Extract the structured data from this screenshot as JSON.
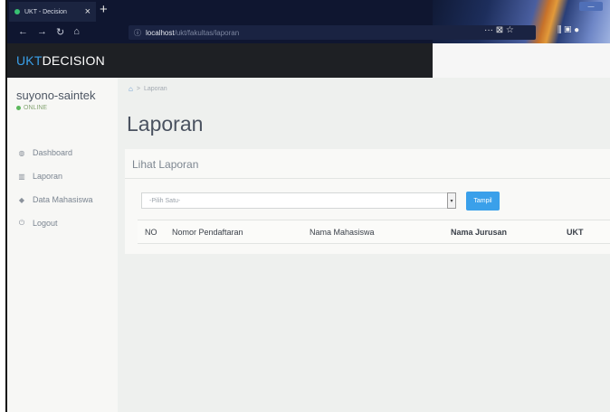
{
  "browser": {
    "tab_title": "UKT - Decision",
    "tab_close": "×",
    "new_tab": "+",
    "url_info_icon": "ⓘ",
    "url_host": "localhost",
    "url_path": "/ukt/fakultas/laporan",
    "page_actions": "··· ⊠ ☆",
    "toolbar_icons": "⫼ ▣ ●"
  },
  "app": {
    "brand_prefix": "UKT",
    "brand_suffix": "DECISION",
    "accent_color": "#3aa0ea"
  },
  "sidebar": {
    "user_name": "suyono-saintek",
    "status": "ONLINE",
    "items": [
      {
        "label": "Dashboard",
        "icon": "dashboard-icon",
        "glyph": "◍"
      },
      {
        "label": "Laporan",
        "icon": "bar-chart-icon",
        "glyph": "▥"
      },
      {
        "label": "Data Mahasiswa",
        "icon": "graduation-cap-icon",
        "glyph": "◆"
      },
      {
        "label": "Logout",
        "icon": "power-icon",
        "glyph": "⏻"
      }
    ]
  },
  "main": {
    "breadcrumb": {
      "home_icon": "home-icon",
      "home_glyph": "⌂",
      "separator": ">",
      "current": "Laporan"
    },
    "title": "Laporan",
    "panel": {
      "title": "Lihat Laporan",
      "select_value": "-Pilih Satu-",
      "select_arrow": "▾",
      "button_label": "Tampil",
      "columns": [
        "NO",
        "Nomor Pendaftaran",
        "Nama Mahasiswa",
        "Nama Jurusan",
        "UKT"
      ]
    }
  }
}
